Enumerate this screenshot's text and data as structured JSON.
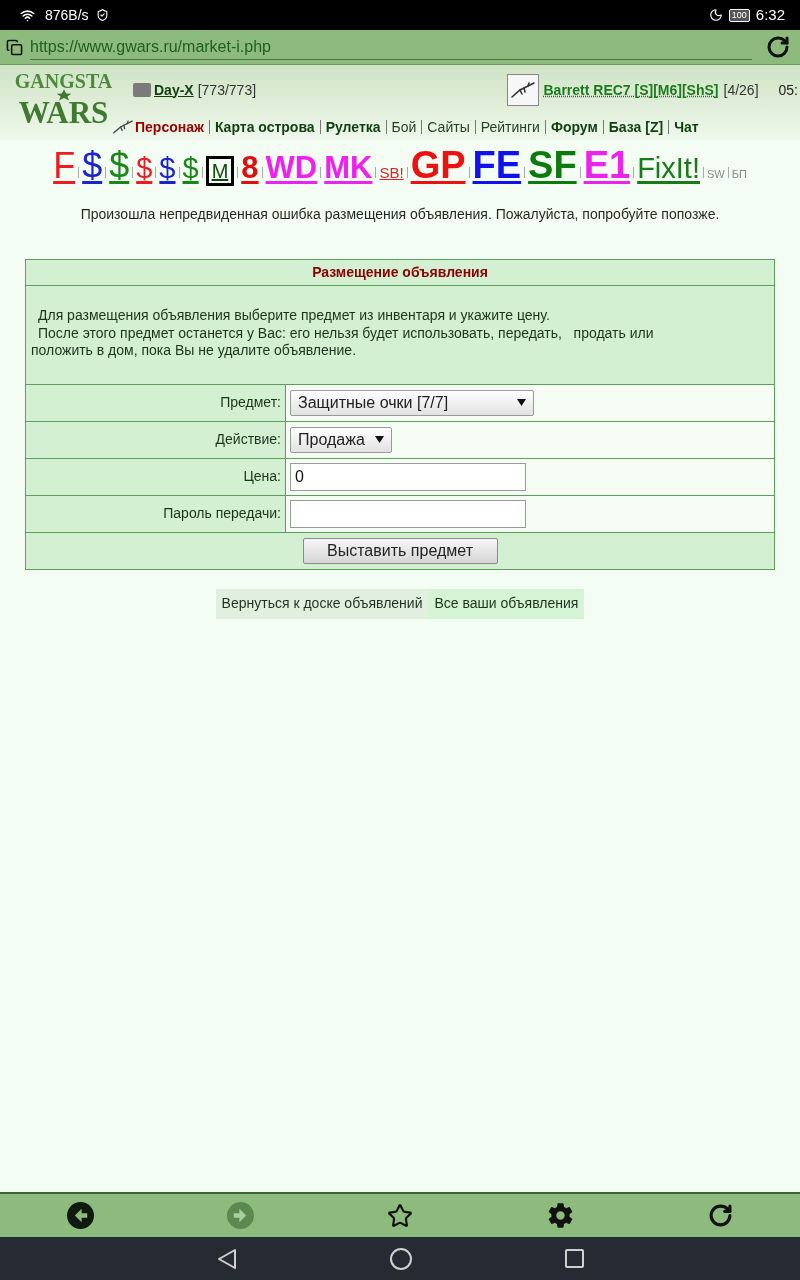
{
  "status_bar": {
    "net_speed": "876B/s",
    "battery": "100",
    "time": "6:32"
  },
  "address_bar": {
    "url": "https://www.gwars.ru/market-i.php"
  },
  "header": {
    "logo": {
      "top": "GANGSTA",
      "bottom": "WARS"
    },
    "player": {
      "name": "Day-X",
      "health": "[773/773]"
    },
    "weapon": {
      "name": "Barrett REC7 [S][M6][ShS]",
      "ammo": "[4/26]"
    },
    "clock": "05:"
  },
  "nav": [
    {
      "label": "Персонаж",
      "kind": "current"
    },
    {
      "label": "Карта острова",
      "kind": "main"
    },
    {
      "label": "Рулетка",
      "kind": "main"
    },
    {
      "label": "Бой",
      "kind": "plain"
    },
    {
      "label": "Сайты",
      "kind": "plain"
    },
    {
      "label": "Рейтинги",
      "kind": "plain"
    },
    {
      "label": "Форум",
      "kind": "main"
    },
    {
      "label": "База [Z]",
      "kind": "main"
    },
    {
      "label": "Чат",
      "kind": "main"
    }
  ],
  "quick_links": [
    {
      "label": "F",
      "kind": "regular",
      "color": "#ec1c24"
    },
    {
      "label": "$",
      "kind": "regular",
      "color": "#1c22cc"
    },
    {
      "label": "$",
      "kind": "regular",
      "color": "#1a861a"
    },
    {
      "label": "$",
      "kind": "medium",
      "color": "#ec1c24"
    },
    {
      "label": "$",
      "kind": "medium",
      "color": "#1c22cc"
    },
    {
      "label": "$",
      "kind": "medium",
      "color": "#1a861a"
    },
    {
      "label": "M",
      "kind": "boxed",
      "color": "#0e4a0e"
    },
    {
      "label": "8",
      "kind": "bold",
      "color": "#dd1111"
    },
    {
      "label": "WD",
      "kind": "bold",
      "color": "#ee22ee"
    },
    {
      "label": "MK",
      "kind": "bold",
      "color": "#ee22ee"
    },
    {
      "label": "SB!",
      "kind": "small",
      "color": "#dd2222"
    },
    {
      "label": "GP",
      "kind": "big",
      "color": "#ee1111"
    },
    {
      "label": "FE",
      "kind": "big",
      "color": "#1111ee"
    },
    {
      "label": "SF",
      "kind": "big",
      "color": "#0e7a0e"
    },
    {
      "label": "E1",
      "kind": "big",
      "color": "#ee22ee"
    },
    {
      "label": "FixIt!",
      "kind": "medium",
      "color": "#1a7a1a"
    },
    {
      "label": "SW",
      "kind": "tiny",
      "color": "#8a8a8a"
    },
    {
      "label": "БП",
      "kind": "tiny",
      "color": "#8a8a8a"
    }
  ],
  "error_message": "Произошла непредвиденная ошибка размещения объявления. Пожалуйста, попробуйте попозже.",
  "form": {
    "title": "Размещение объявления",
    "intro": [
      "Для размещения объявления выберите предмет из инвентаря и укажите цену.",
      "После этого предмет останется у Вас: его нельзя будет использовать, передать,   продать или положить в дом, пока Вы не удалите объявление."
    ],
    "fields": [
      {
        "label": "Предмет:",
        "kind": "select",
        "value": "Защитные очки [7/7]"
      },
      {
        "label": "Действие:",
        "kind": "select",
        "value": "Продажа"
      },
      {
        "label": "Цена:",
        "kind": "input",
        "value": "0"
      },
      {
        "label": "Пароль передачи:",
        "kind": "input"
      }
    ],
    "submit": "Выставить предмет"
  },
  "links": [
    {
      "label": "Вернуться к доске объявлений"
    },
    {
      "label": "Все ваши объявления"
    }
  ],
  "browser_toolbar": {
    "back_disabled": false,
    "forward_disabled": true
  }
}
